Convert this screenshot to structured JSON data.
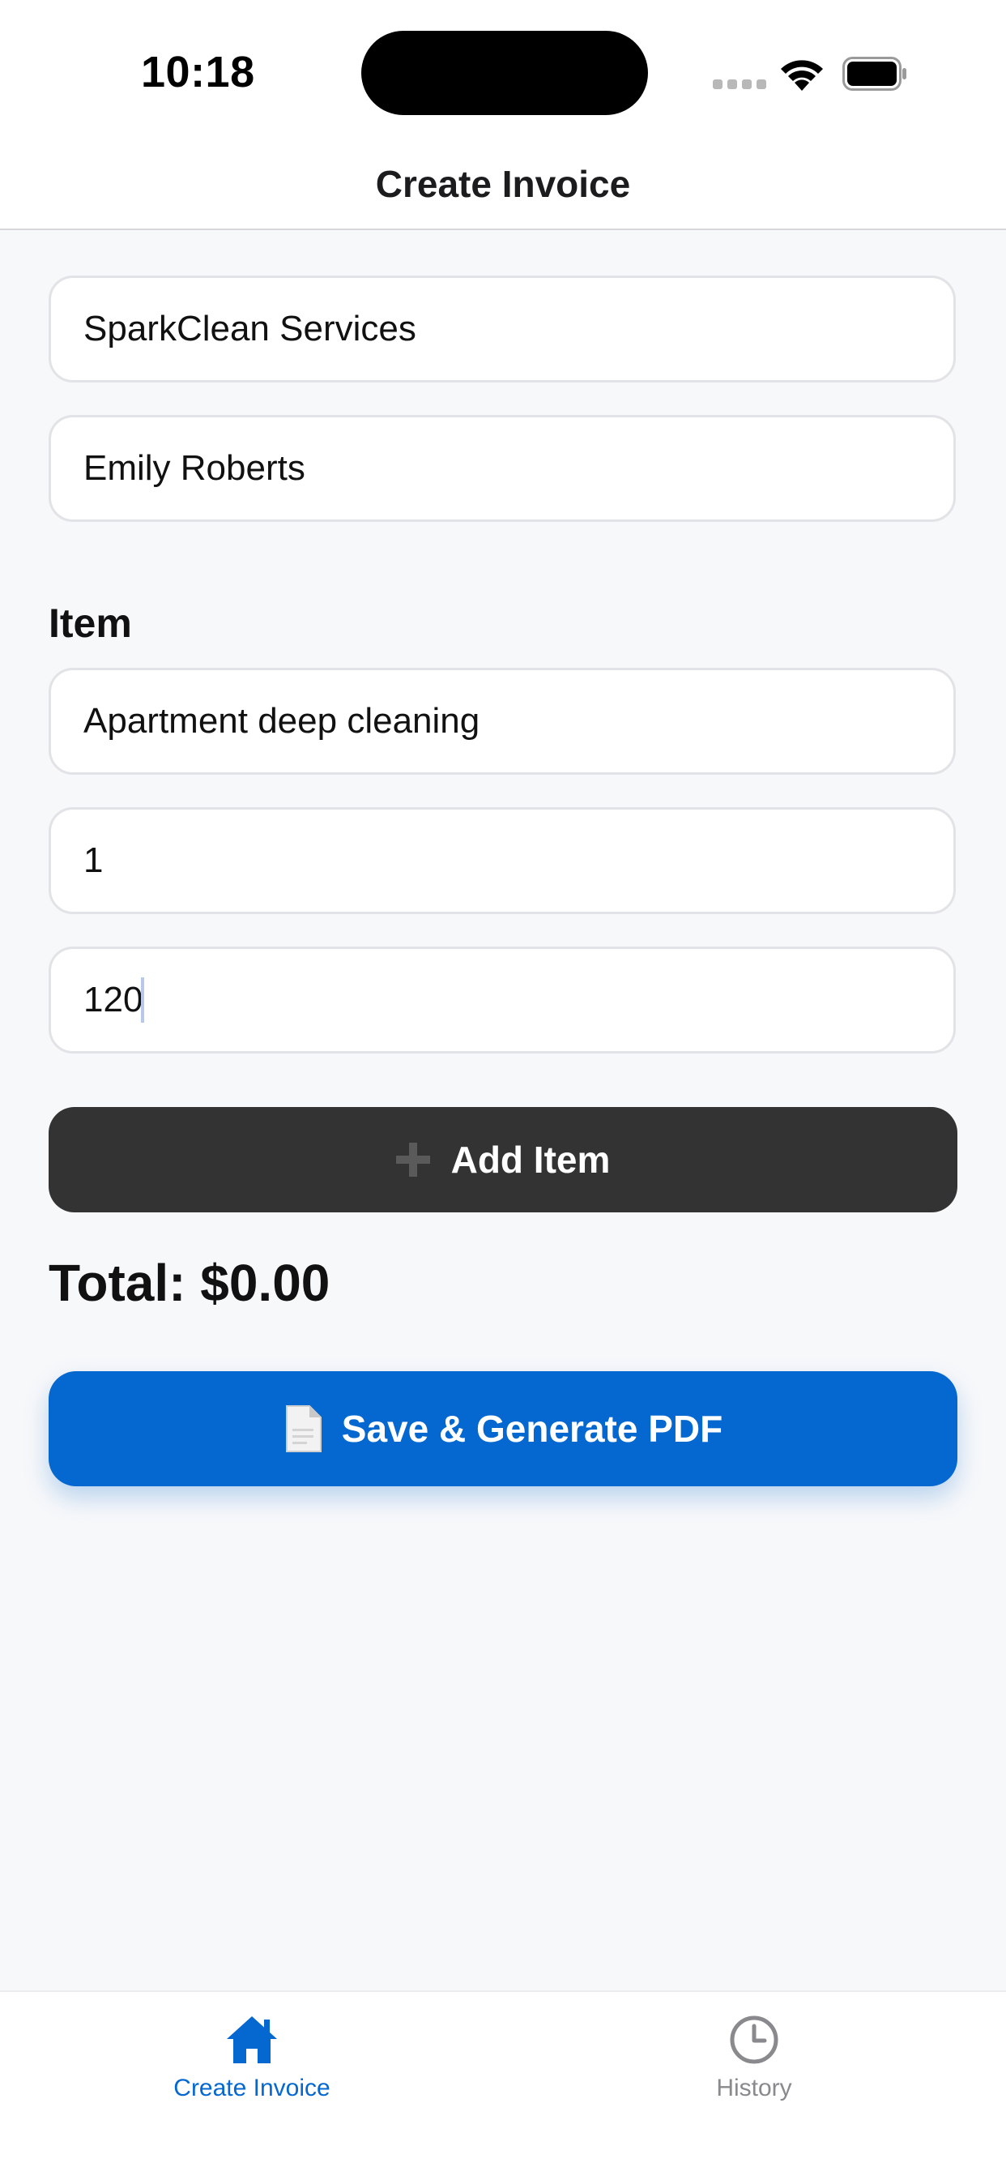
{
  "status_bar": {
    "time": "10:18"
  },
  "nav": {
    "title": "Create Invoice"
  },
  "form": {
    "business_name": {
      "value": "SparkClean Services"
    },
    "client_name": {
      "value": "Emily Roberts"
    },
    "item_section_label": "Item",
    "item_description": {
      "value": "Apartment deep cleaning"
    },
    "item_quantity": {
      "value": "1"
    },
    "item_price": {
      "value": "120"
    }
  },
  "actions": {
    "add_item_label": "Add Item",
    "add_item_icon": "plus-icon",
    "save_label": "Save & Generate PDF",
    "save_icon": "document-icon"
  },
  "total": {
    "text": "Total: $0.00"
  },
  "tab_bar": {
    "tabs": [
      {
        "label": "Create Invoice",
        "icon": "home-icon",
        "active": true
      },
      {
        "label": "History",
        "icon": "clock-icon",
        "active": false
      }
    ]
  },
  "colors": {
    "accent": "#0468d0",
    "dark_button": "#333333",
    "background": "#f7f8fa",
    "inactive_tab": "#8a8a8e"
  }
}
